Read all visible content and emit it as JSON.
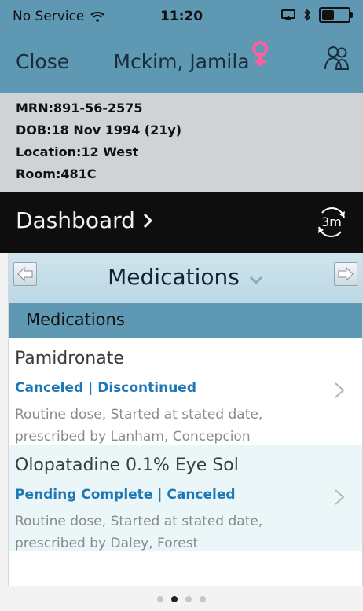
{
  "status_bar": {
    "carrier": "No Service",
    "time": "11:20",
    "battery_level_percent": 55
  },
  "nav": {
    "close_label": "Close",
    "patient_name": "Mckim, Jamila"
  },
  "patient": {
    "mrn": "MRN:891-56-2575",
    "dob": "DOB:18 Nov 1994 (21y)",
    "location": "Location:12 West",
    "room": "Room:481C"
  },
  "dashboard": {
    "title": "Dashboard",
    "refresh_label": "3m"
  },
  "card": {
    "title": "Medications",
    "section_label": "Medications",
    "items": [
      {
        "name": "Pamidronate",
        "status": "Canceled | Discontinued",
        "description": "Routine dose, Started at stated date, prescribed by Lanham, Concepcion"
      },
      {
        "name": "Olopatadine 0.1% Eye Sol",
        "status": "Pending Complete | Canceled",
        "description": "Routine dose, Started at stated date, prescribed by Daley, Forest"
      }
    ]
  },
  "pager": {
    "total": 4,
    "active_index": 1
  },
  "colors": {
    "nav_bar": "#5f98b3",
    "status_text": "#1f78b4",
    "female_symbol": "#ff5fa0"
  }
}
